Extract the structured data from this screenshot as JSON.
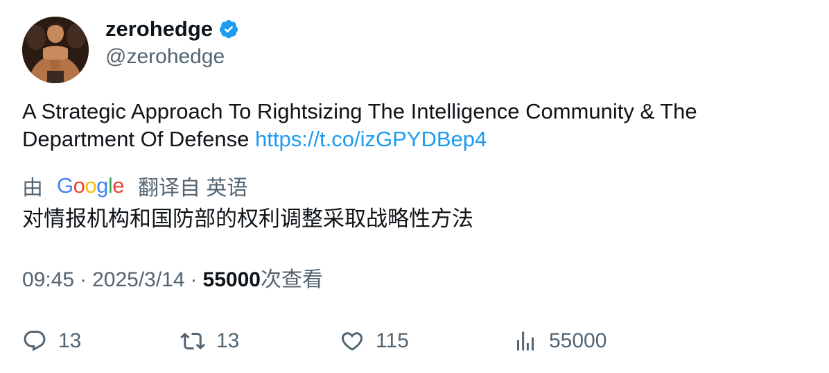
{
  "author": {
    "display_name": "zerohedge",
    "handle": "@zerohedge",
    "verified": true,
    "verified_color": "#1d9bf0"
  },
  "tweet": {
    "text": "A Strategic Approach To Rightsizing The Intelligence Community & The Department Of Defense ",
    "link": "https://t.co/izGPYDBep4",
    "link_color": "#1d9bf0"
  },
  "translation": {
    "prefix": "由",
    "provider": "Google",
    "suffix": "翻译自 英语",
    "translated_text": "对情报机构和国防部的权利调整采取战略性方法"
  },
  "meta": {
    "time": "09:45",
    "separator": "·",
    "date": "2025/3/14",
    "views_count": "55000",
    "views_label": "次查看"
  },
  "actions": {
    "replies": "13",
    "retweets": "13",
    "likes": "115",
    "views": "55000"
  },
  "icons": {
    "reply": "reply-icon",
    "retweet": "retweet-icon",
    "like": "heart-icon",
    "views": "analytics-icon",
    "verified": "verified-badge-icon"
  }
}
